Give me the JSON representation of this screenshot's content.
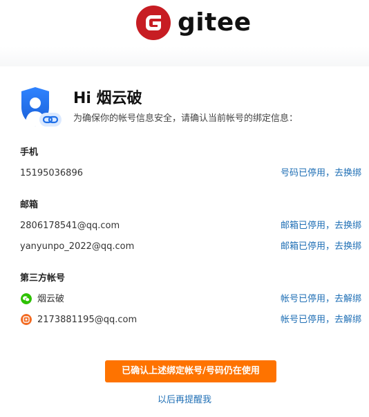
{
  "brand": {
    "name": "gitee"
  },
  "greeting": "Hi 烟云破",
  "intro": "为确保你的帐号信息安全，请确认当前帐号的绑定信息：",
  "phone": {
    "title": "手机",
    "items": [
      {
        "value": "15195036896",
        "action": "号码已停用，去换绑"
      }
    ]
  },
  "email": {
    "title": "邮箱",
    "items": [
      {
        "value": "2806178541@qq.com",
        "action": "邮箱已停用，去换绑"
      },
      {
        "value": "yanyunpo_2022@qq.com",
        "action": "邮箱已停用，去换绑"
      }
    ]
  },
  "third_party": {
    "title": "第三方帐号",
    "items": [
      {
        "icon": "wechat-icon",
        "value": "烟云破",
        "action": "帐号已停用，去解绑"
      },
      {
        "icon": "qq-mail-icon",
        "value": "2173881195@qq.com",
        "action": "帐号已停用，去解绑"
      }
    ]
  },
  "confirm_button": "已确认上述绑定帐号/号码仍在使用",
  "later_link": "以后再提醒我",
  "colors": {
    "brand_red": "#c71d23",
    "accent_orange": "#fe7300",
    "link_blue": "#1f6fb5",
    "wechat_green": "#2dc100",
    "qq_orange": "#f26a21",
    "shield_blue": "#1f6fe8"
  }
}
